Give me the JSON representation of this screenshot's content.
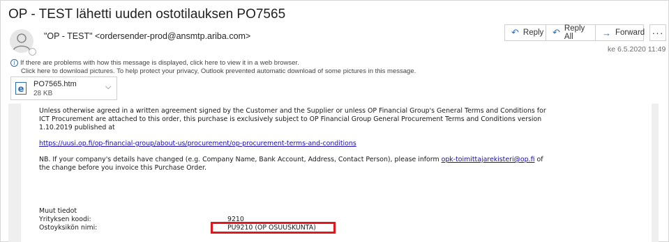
{
  "subject": "OP - TEST lähetti uuden ostotilauksen PO7565",
  "sender": "\"OP - TEST\" <ordersender-prod@ansmtp.ariba.com>",
  "actions": {
    "reply": "Reply",
    "reply_all": "Reply All",
    "forward": "Forward",
    "more": "···"
  },
  "date": "ke 6.5.2020 11:49",
  "info": {
    "line1": "If there are problems with how this message is displayed, click here to view it in a web browser.",
    "line2": "Click here to download pictures. To help protect your privacy, Outlook prevented automatic download of some pictures in this message."
  },
  "attachment": {
    "name": "PO7565.htm",
    "size": "28 KB"
  },
  "body": {
    "p1_line1": "Unless otherwise agreed in a written agreement signed by the Customer and the Supplier or unless OP Financial Group's General Terms and Conditions for",
    "p1_line2": "ICT Procurement are attached to this order, this purchase is exclusively subject to OP Financial Group General Procurement Terms and Conditions version",
    "p1_line3": "1.10.2019 published at",
    "terms_link": "https://uusi.op.fi/op-financial-group/about-us/procurement/op-procurement-terms-and-conditions",
    "nb_line1": "NB. If your company's details have changed (e.g. Company Name, Bank Account, Address, Contact Person), please inform",
    "nb_email": "opk-toimittajarekisteri@op.fi",
    "nb_of": "of",
    "nb_line2": "the change before you invoice this Purchase Order.",
    "misc_title": "Muut tiedot",
    "company_code_label": "Yrityksen koodi:",
    "company_code_value": "9210",
    "unit_name_label": "Ostoyksikön nimi:",
    "unit_name_value": "PU9210 (OP OSUUSKUNTA)"
  },
  "colors": {
    "accent": "#2b6cb8",
    "highlight_box": "#e4161b",
    "link": "#1a0dab"
  }
}
